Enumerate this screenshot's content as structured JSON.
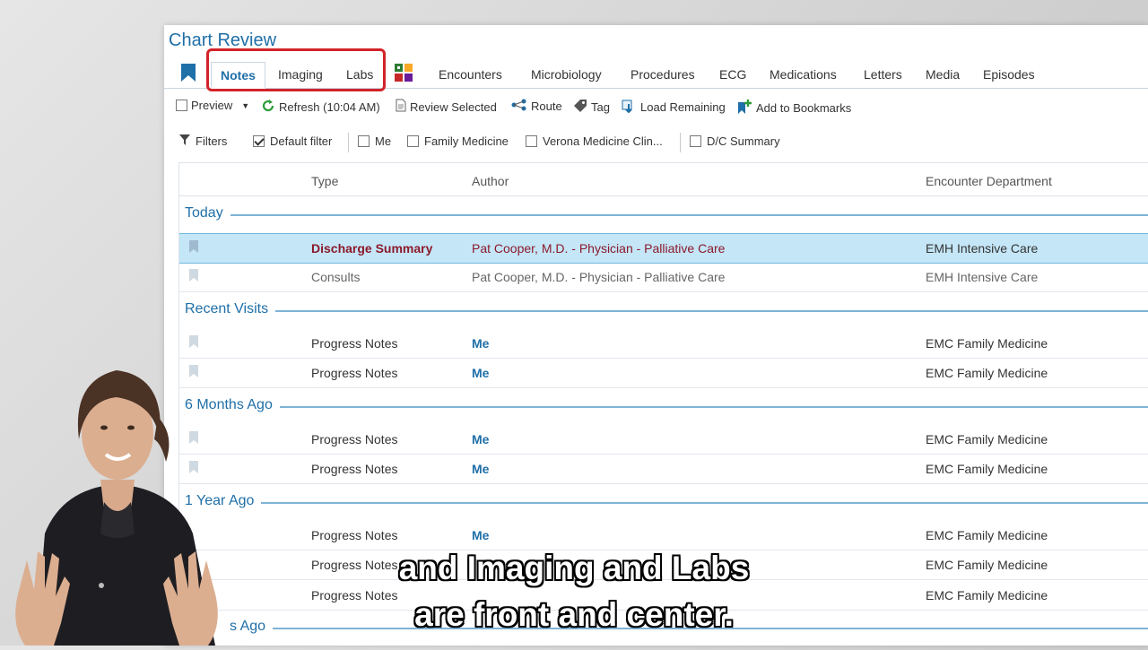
{
  "window": {
    "title": "Chart Review"
  },
  "tabs": [
    {
      "label": "Notes",
      "active": true
    },
    {
      "label": "Imaging"
    },
    {
      "label": "Labs"
    },
    {
      "label": "Encounters"
    },
    {
      "label": "Microbiology"
    },
    {
      "label": "Procedures"
    },
    {
      "label": "ECG"
    },
    {
      "label": "Medications"
    },
    {
      "label": "Letters"
    },
    {
      "label": "Media"
    },
    {
      "label": "Episodes"
    }
  ],
  "toolbar": {
    "preview": "Preview",
    "refresh": "Refresh (10:04 AM)",
    "review_selected": "Review Selected",
    "route": "Route",
    "tag": "Tag",
    "load_remaining": "Load Remaining",
    "add_to_bookmarks": "Add to Bookmarks"
  },
  "filters": {
    "label": "Filters",
    "default_filter": "Default filter",
    "me": "Me",
    "family_medicine": "Family Medicine",
    "verona": "Verona Medicine Clin...",
    "dc_summary": "D/C Summary"
  },
  "columns": {
    "type": "Type",
    "author": "Author",
    "dept": "Encounter Department"
  },
  "groups": {
    "today": "Today",
    "recent": "Recent Visits",
    "six_months": "6 Months Ago",
    "one_year": "1 Year Ago",
    "partial": "s Ago"
  },
  "rows": [
    {
      "type": "Discharge Summary",
      "author": "Pat Cooper, M.D. - Physician - Palliative Care",
      "dept": "EMH Intensive Care"
    },
    {
      "type": "Consults",
      "author": "Pat Cooper, M.D. - Physician - Palliative Care",
      "dept": "EMH Intensive Care"
    },
    {
      "type": "Progress Notes",
      "author": "Me",
      "dept": "EMC Family Medicine"
    },
    {
      "type": "Progress Notes",
      "author": "Me",
      "dept": "EMC Family Medicine"
    },
    {
      "type": "Progress Notes",
      "author": "Me",
      "dept": "EMC Family Medicine"
    },
    {
      "type": "Progress Notes",
      "author": "Me",
      "dept": "EMC Family Medicine"
    },
    {
      "type": "Progress Notes",
      "author": "Me",
      "dept": "EMC Family Medicine"
    },
    {
      "type": "Progress Notes",
      "author": "",
      "dept": "EMC Family Medicine"
    },
    {
      "type": "Progress Notes",
      "author": "",
      "dept": "EMC Family Medicine"
    }
  ],
  "caption": {
    "line1": "and Imaging and Labs",
    "line2": "are front and center."
  },
  "colors": {
    "accent": "#1f6fa8",
    "highlight": "#d2232a",
    "selected_row": "#c4e6f7"
  }
}
